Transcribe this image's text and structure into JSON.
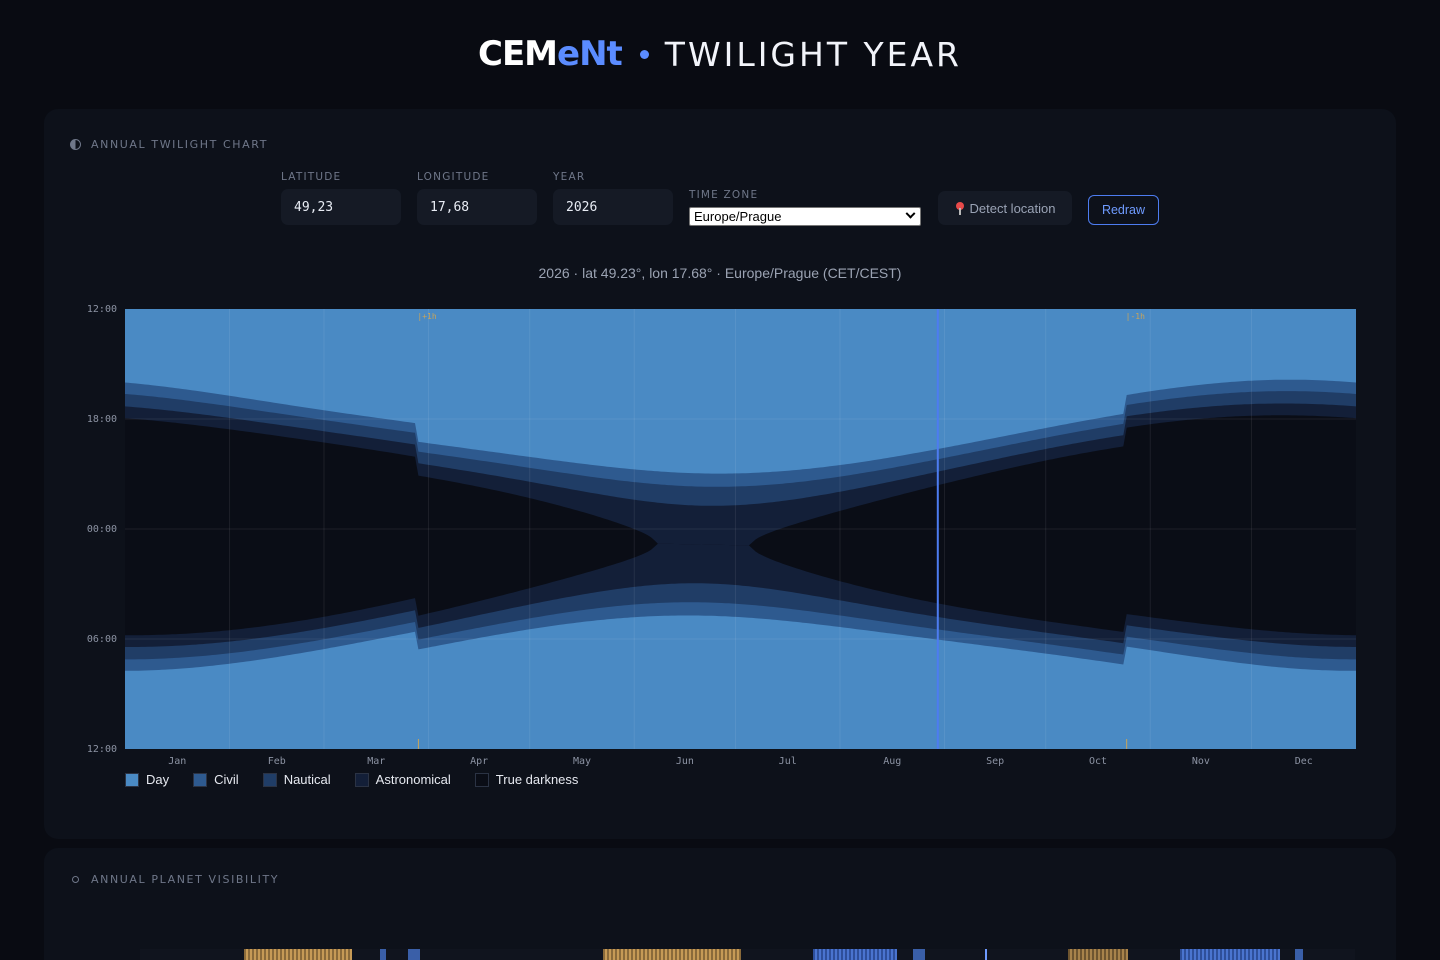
{
  "header": {
    "logo_text_a": "CEM",
    "logo_text_b": "e",
    "logo_text_c": "Nt",
    "title": "TWILIGHT YEAR"
  },
  "twilight_card": {
    "label": "ANNUAL TWILIGHT CHART",
    "icon": "half-circle-icon",
    "fields": {
      "latitude": {
        "label": "LATITUDE",
        "value": "49,23"
      },
      "longitude": {
        "label": "LONGITUDE",
        "value": "17,68"
      },
      "year": {
        "label": "YEAR",
        "value": "2026"
      },
      "timezone": {
        "label": "TIME ZONE",
        "value": "Europe/Prague"
      }
    },
    "detect_button": "Detect location",
    "redraw_button": "Redraw",
    "subtitle": "2026 · lat 49.23°, lon 17.68° · Europe/Prague (CET/CEST)"
  },
  "planet_card": {
    "label": "ANNUAL PLANET VISIBILITY",
    "icon": "ring-icon"
  },
  "colors": {
    "day": "#4a8ac4",
    "civil": "#2e5a8f",
    "nautical": "#203d66",
    "astronomical": "#131f38",
    "darkness": "#0a0d16",
    "today_marker": "#4d7cf0",
    "dst_marker": "#c8a45a",
    "accent": "#5b8cff"
  },
  "chart_data": {
    "type": "area",
    "title": "",
    "y_axis_labels": [
      "12:00",
      "18:00",
      "00:00",
      "06:00",
      "12:00"
    ],
    "y_axis_hours_from_noon": [
      0,
      6,
      12,
      18,
      24
    ],
    "months": [
      "Jan",
      "Feb",
      "Mar",
      "Apr",
      "May",
      "Jun",
      "Jul",
      "Aug",
      "Sep",
      "Oct",
      "Nov",
      "Dec"
    ],
    "dst_start": {
      "date": "2026-03-29",
      "label": "|+1h"
    },
    "dst_end": {
      "date": "2026-10-25",
      "label": "|-1h"
    },
    "today_marker_date": "2026-08-30",
    "latitude": 49.23,
    "longitude": 17.68,
    "timezone_offsets_hours": {
      "standard": 1,
      "summer": 2
    },
    "bands": [
      "Day",
      "Civil",
      "Nautical",
      "Astronomical",
      "True darkness"
    ],
    "sun_altitude_thresholds_deg": {
      "day": -0.833,
      "civil": -6,
      "nautical": -12,
      "astronomical": -18
    }
  },
  "legend": [
    {
      "label": "Day",
      "color": "#4a8ac4"
    },
    {
      "label": "Civil",
      "color": "#2e5a8f"
    },
    {
      "label": "Nautical",
      "color": "#203d66"
    },
    {
      "label": "Astronomical",
      "color": "#131f38"
    },
    {
      "label": "True darkness",
      "color": "#0a0d16"
    }
  ]
}
